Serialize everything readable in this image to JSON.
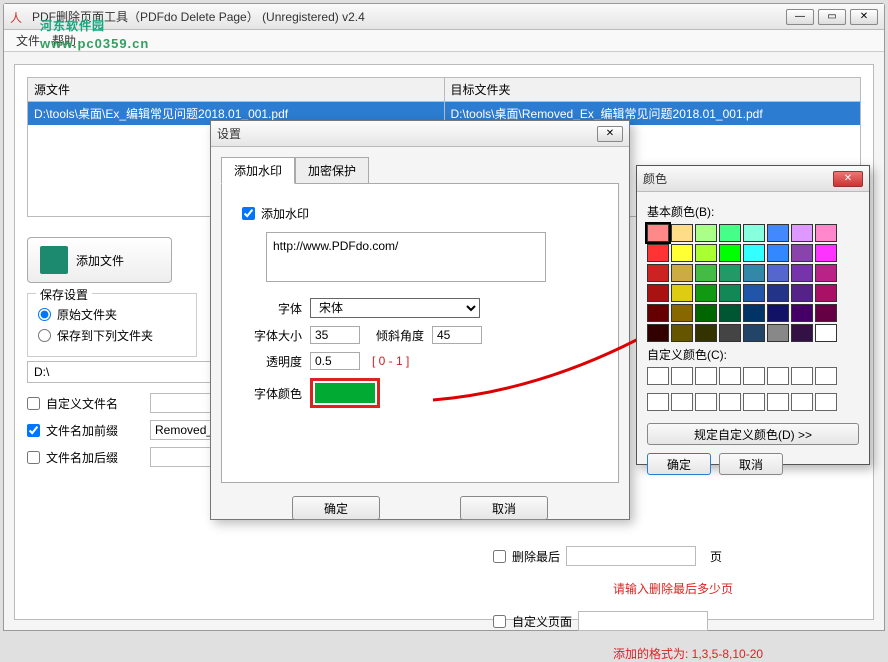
{
  "main": {
    "title": "PDF删除页面工具（PDFdo Delete Page）  (Unregistered) v2.4",
    "menu": {
      "file": "文件",
      "help": "帮助"
    }
  },
  "watermark": {
    "line1": "河东软件园",
    "line2": "www.pc0359.cn"
  },
  "table": {
    "src_head": "源文件",
    "dst_head": "目标文件夹",
    "src_row": "D:\\tools\\桌面\\Ex_编辑常见问题2018.01_001.pdf",
    "dst_row": "D:\\tools\\桌面\\Removed_Ex_编辑常见问题2018.01_001.pdf"
  },
  "addFile": "添加文件",
  "save": {
    "legend": "保存设置",
    "orig": "原始文件夹",
    "target": "保存到下列文件夹",
    "path": "D:\\",
    "custName": "自定义文件名",
    "prefix": "文件名加前缀",
    "prefixVal": "Removed_",
    "suffix": "文件名加后缀"
  },
  "right": {
    "delLast": "删除最后",
    "pageUnit": "页",
    "hint1": "请输入删除最后多少页",
    "custom": "自定义页面",
    "hint2": "添加的格式为:  1,3,5-8,10-20"
  },
  "dialog": {
    "title": "设置",
    "tab1": "添加水印",
    "tab2": "加密保护",
    "addWm": "添加水印",
    "wmText": "http://www.PDFdo.com/",
    "fontLbl": "字体",
    "fontVal": "宋体",
    "sizeLbl": "字体大小",
    "sizeVal": "35",
    "angleLbl": "倾斜角度",
    "angleVal": "45",
    "opLbl": "透明度",
    "opVal": "0.5",
    "opRange": "[ 0 - 1 ]",
    "colorLbl": "字体颜色",
    "ok": "确定",
    "cancel": "取消"
  },
  "color": {
    "title": "颜色",
    "basic": "基本颜色(B):",
    "custom": "自定义颜色(C):",
    "define": "规定自定义颜色(D) >>",
    "ok": "确定",
    "cancel": "取消",
    "swatches": [
      "#ff8888",
      "#ffdd88",
      "#aaff88",
      "#44ff88",
      "#88ffdd",
      "#4488ff",
      "#dd99ff",
      "#ff88cc",
      "#ff3333",
      "#ffff33",
      "#aaff33",
      "#00ff00",
      "#33ffff",
      "#3388ff",
      "#8844aa",
      "#ff33ff",
      "#cc2222",
      "#ccaa44",
      "#44bb44",
      "#229966",
      "#3388aa",
      "#5566cc",
      "#7733aa",
      "#bb2288",
      "#aa1111",
      "#ddcc11",
      "#119911",
      "#118855",
      "#2255aa",
      "#223388",
      "#552288",
      "#aa1166",
      "#660000",
      "#886600",
      "#006600",
      "#005533",
      "#003366",
      "#111166",
      "#440066",
      "#660044",
      "#330000",
      "#665500",
      "#333300",
      "#444444",
      "#224466",
      "#888888",
      "#331144",
      "#ffffff"
    ]
  }
}
